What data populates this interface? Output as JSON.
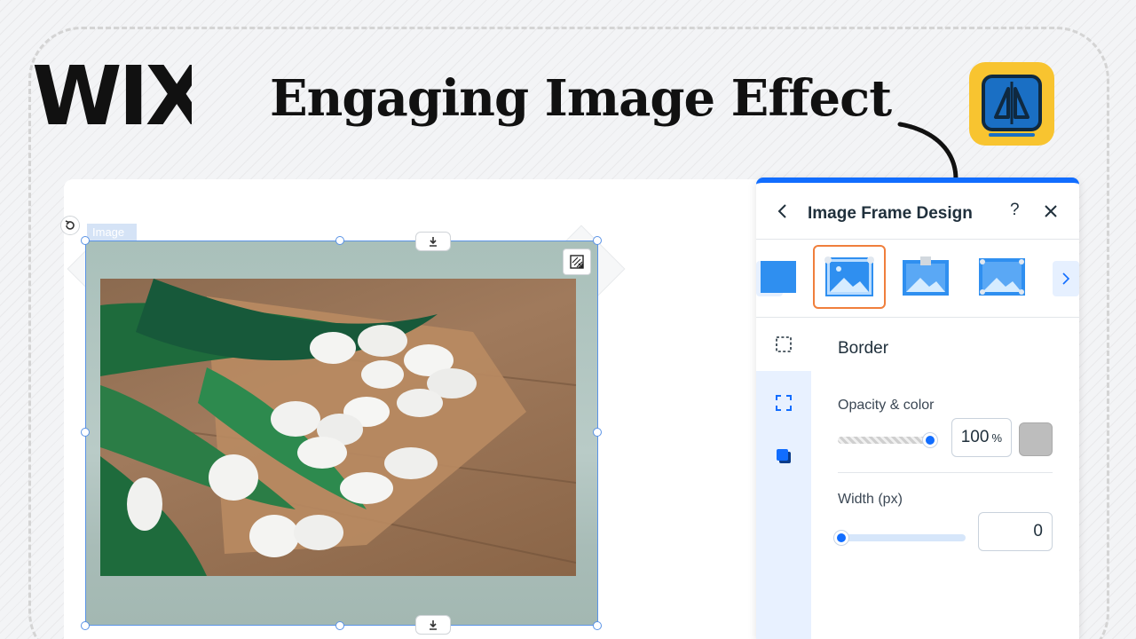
{
  "header": {
    "logo_text": "WIX",
    "headline": "Engaging Image Effect",
    "app_icon_name": "mirror-split-icon"
  },
  "canvas": {
    "element_tag": "Image"
  },
  "panel": {
    "title": "Image Frame Design",
    "help_label": "?",
    "border_section": {
      "title": "Border",
      "opacity_label": "Opacity & color",
      "opacity_value": "100",
      "opacity_unit": "%",
      "opacity_fraction": 1.0,
      "color_hex": "#bdbdbd",
      "width_label": "Width (px)",
      "width_value": "0",
      "width_fraction": 0.0
    },
    "frame_thumbnails": [
      "frame-style-1",
      "frame-style-2-selected",
      "frame-style-3",
      "frame-style-4"
    ],
    "rail_icons": [
      "dashed-square-icon",
      "corner-frame-icon",
      "shadow-square-icon"
    ]
  },
  "colors": {
    "accent": "#116dff",
    "selected_frame": "#f07f3c",
    "app_icon_bg": "#f8c430"
  }
}
